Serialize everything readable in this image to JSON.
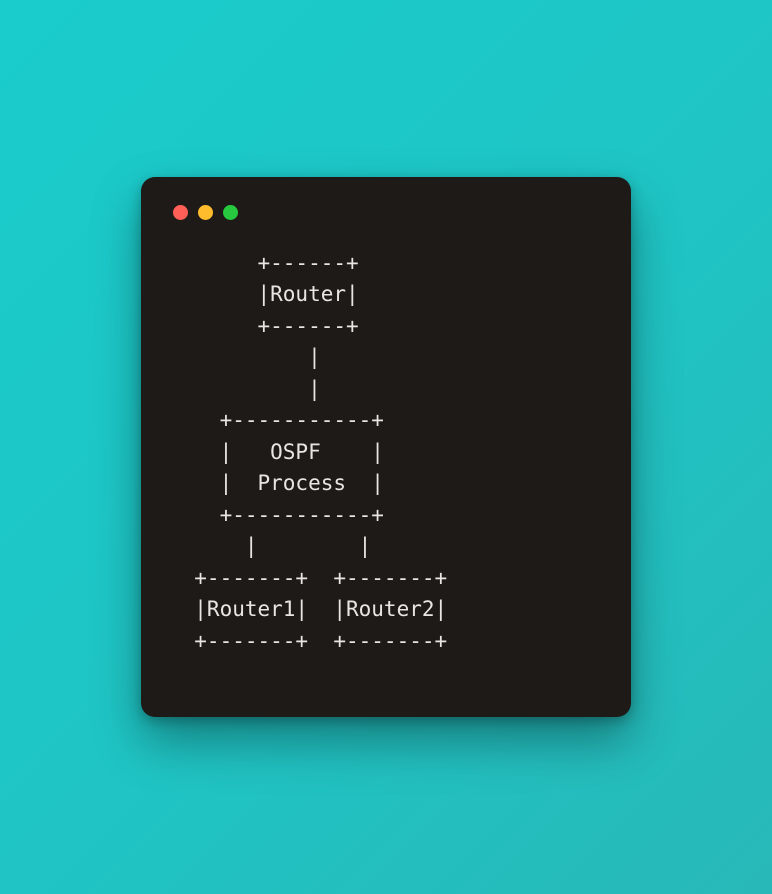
{
  "window": {
    "traffic_lights": {
      "red": "#FF5F56",
      "yellow": "#FFBD2E",
      "green": "#27C93F"
    }
  },
  "diagram": {
    "lines": [
      "       +------+",
      "       |Router|",
      "       +------+",
      "           |",
      "           |",
      "    +-----------+",
      "    |   OSPF    |",
      "    |  Process  |",
      "    +-----------+",
      "      |        |",
      "  +-------+  +-------+",
      "  |Router1|  |Router2|",
      "  +-------+  +-------+"
    ],
    "nodes": {
      "top": "Router",
      "middle": "OSPF Process",
      "bottom_left": "Router1",
      "bottom_right": "Router2"
    }
  }
}
